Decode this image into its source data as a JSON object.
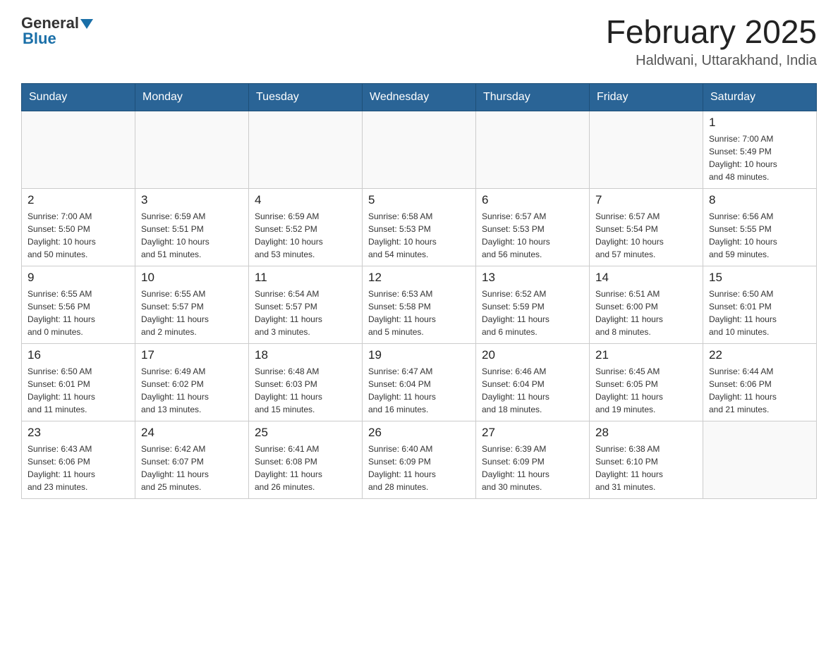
{
  "header": {
    "logo_general": "General",
    "logo_blue": "Blue",
    "title": "February 2025",
    "subtitle": "Haldwani, Uttarakhand, India"
  },
  "days_of_week": [
    "Sunday",
    "Monday",
    "Tuesday",
    "Wednesday",
    "Thursday",
    "Friday",
    "Saturday"
  ],
  "weeks": [
    [
      {
        "day": "",
        "info": ""
      },
      {
        "day": "",
        "info": ""
      },
      {
        "day": "",
        "info": ""
      },
      {
        "day": "",
        "info": ""
      },
      {
        "day": "",
        "info": ""
      },
      {
        "day": "",
        "info": ""
      },
      {
        "day": "1",
        "info": "Sunrise: 7:00 AM\nSunset: 5:49 PM\nDaylight: 10 hours\nand 48 minutes."
      }
    ],
    [
      {
        "day": "2",
        "info": "Sunrise: 7:00 AM\nSunset: 5:50 PM\nDaylight: 10 hours\nand 50 minutes."
      },
      {
        "day": "3",
        "info": "Sunrise: 6:59 AM\nSunset: 5:51 PM\nDaylight: 10 hours\nand 51 minutes."
      },
      {
        "day": "4",
        "info": "Sunrise: 6:59 AM\nSunset: 5:52 PM\nDaylight: 10 hours\nand 53 minutes."
      },
      {
        "day": "5",
        "info": "Sunrise: 6:58 AM\nSunset: 5:53 PM\nDaylight: 10 hours\nand 54 minutes."
      },
      {
        "day": "6",
        "info": "Sunrise: 6:57 AM\nSunset: 5:53 PM\nDaylight: 10 hours\nand 56 minutes."
      },
      {
        "day": "7",
        "info": "Sunrise: 6:57 AM\nSunset: 5:54 PM\nDaylight: 10 hours\nand 57 minutes."
      },
      {
        "day": "8",
        "info": "Sunrise: 6:56 AM\nSunset: 5:55 PM\nDaylight: 10 hours\nand 59 minutes."
      }
    ],
    [
      {
        "day": "9",
        "info": "Sunrise: 6:55 AM\nSunset: 5:56 PM\nDaylight: 11 hours\nand 0 minutes."
      },
      {
        "day": "10",
        "info": "Sunrise: 6:55 AM\nSunset: 5:57 PM\nDaylight: 11 hours\nand 2 minutes."
      },
      {
        "day": "11",
        "info": "Sunrise: 6:54 AM\nSunset: 5:57 PM\nDaylight: 11 hours\nand 3 minutes."
      },
      {
        "day": "12",
        "info": "Sunrise: 6:53 AM\nSunset: 5:58 PM\nDaylight: 11 hours\nand 5 minutes."
      },
      {
        "day": "13",
        "info": "Sunrise: 6:52 AM\nSunset: 5:59 PM\nDaylight: 11 hours\nand 6 minutes."
      },
      {
        "day": "14",
        "info": "Sunrise: 6:51 AM\nSunset: 6:00 PM\nDaylight: 11 hours\nand 8 minutes."
      },
      {
        "day": "15",
        "info": "Sunrise: 6:50 AM\nSunset: 6:01 PM\nDaylight: 11 hours\nand 10 minutes."
      }
    ],
    [
      {
        "day": "16",
        "info": "Sunrise: 6:50 AM\nSunset: 6:01 PM\nDaylight: 11 hours\nand 11 minutes."
      },
      {
        "day": "17",
        "info": "Sunrise: 6:49 AM\nSunset: 6:02 PM\nDaylight: 11 hours\nand 13 minutes."
      },
      {
        "day": "18",
        "info": "Sunrise: 6:48 AM\nSunset: 6:03 PM\nDaylight: 11 hours\nand 15 minutes."
      },
      {
        "day": "19",
        "info": "Sunrise: 6:47 AM\nSunset: 6:04 PM\nDaylight: 11 hours\nand 16 minutes."
      },
      {
        "day": "20",
        "info": "Sunrise: 6:46 AM\nSunset: 6:04 PM\nDaylight: 11 hours\nand 18 minutes."
      },
      {
        "day": "21",
        "info": "Sunrise: 6:45 AM\nSunset: 6:05 PM\nDaylight: 11 hours\nand 19 minutes."
      },
      {
        "day": "22",
        "info": "Sunrise: 6:44 AM\nSunset: 6:06 PM\nDaylight: 11 hours\nand 21 minutes."
      }
    ],
    [
      {
        "day": "23",
        "info": "Sunrise: 6:43 AM\nSunset: 6:06 PM\nDaylight: 11 hours\nand 23 minutes."
      },
      {
        "day": "24",
        "info": "Sunrise: 6:42 AM\nSunset: 6:07 PM\nDaylight: 11 hours\nand 25 minutes."
      },
      {
        "day": "25",
        "info": "Sunrise: 6:41 AM\nSunset: 6:08 PM\nDaylight: 11 hours\nand 26 minutes."
      },
      {
        "day": "26",
        "info": "Sunrise: 6:40 AM\nSunset: 6:09 PM\nDaylight: 11 hours\nand 28 minutes."
      },
      {
        "day": "27",
        "info": "Sunrise: 6:39 AM\nSunset: 6:09 PM\nDaylight: 11 hours\nand 30 minutes."
      },
      {
        "day": "28",
        "info": "Sunrise: 6:38 AM\nSunset: 6:10 PM\nDaylight: 11 hours\nand 31 minutes."
      },
      {
        "day": "",
        "info": ""
      }
    ]
  ]
}
